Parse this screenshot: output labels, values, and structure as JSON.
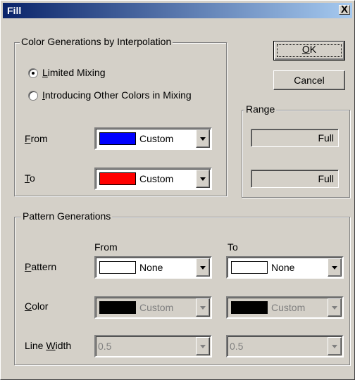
{
  "window": {
    "title": "Fill",
    "close_glyph": "X"
  },
  "interpolation": {
    "legend": "Color Generations by Interpolation",
    "radio_limited": {
      "label": "Limited Mixing",
      "mnemonic": "L",
      "rest": "imited Mixing",
      "selected": true
    },
    "radio_other": {
      "label": "Introducing Other Colors in Mixing",
      "mnemonic": "I",
      "rest": "ntroducing Other Colors in Mixing",
      "selected": false
    },
    "from_label": {
      "text": "From",
      "mnemonic": "F",
      "rest": "rom"
    },
    "to_label": {
      "text": "To",
      "mnemonic": "T",
      "rest": "o"
    },
    "from_combo": {
      "value": "Custom",
      "swatch_color": "#0000ff"
    },
    "to_combo": {
      "value": "Custom",
      "swatch_color": "#ff0000"
    }
  },
  "buttons": {
    "ok": "OK",
    "ok_mnemonic": "O",
    "ok_rest": "K",
    "cancel": "Cancel"
  },
  "range": {
    "legend": "Range",
    "field1": "Full",
    "field2": "Full"
  },
  "pattern": {
    "legend": "Pattern Generations",
    "from_header": "From",
    "to_header": "To",
    "pattern_label": {
      "text": "Pattern",
      "mnemonic": "P",
      "rest": "attern"
    },
    "color_label": {
      "text": "Color",
      "mnemonic": "C",
      "rest": "olor"
    },
    "linewidth_label": {
      "text": "Line Width",
      "pre": "Line ",
      "mnemonic": "W",
      "rest": "idth"
    },
    "pattern_from": {
      "value": "None",
      "swatch_color": "#ffffff"
    },
    "pattern_to": {
      "value": "None",
      "swatch_color": "#ffffff"
    },
    "color_from": {
      "value": "Custom",
      "swatch_color": "#000000",
      "disabled": true
    },
    "color_to": {
      "value": "Custom",
      "swatch_color": "#000000",
      "disabled": true
    },
    "linewidth_from": {
      "value": "0.5",
      "disabled": true
    },
    "linewidth_to": {
      "value": "0.5",
      "disabled": true
    }
  }
}
